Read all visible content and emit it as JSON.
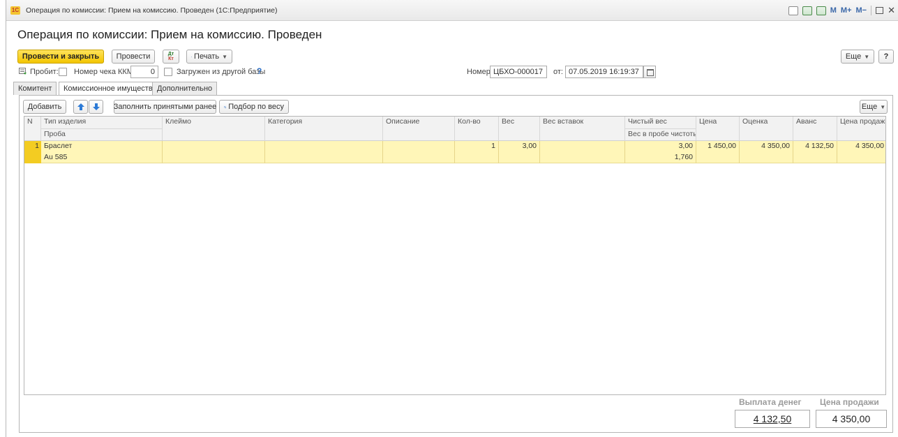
{
  "window": {
    "title": "Операция по комиссии: Прием на комиссию. Проведен  (1С:Предприятие)",
    "logo": "1С",
    "memory_buttons": [
      "M",
      "M+",
      "M−"
    ]
  },
  "document": {
    "title": "Операция по комиссии: Прием на комиссию. Проведен"
  },
  "toolbar": {
    "post_close": "Провести и закрыть",
    "post": "Провести",
    "dtkt_top": "Дт",
    "dtkt_bottom": "Кт",
    "print": "Печать",
    "more": "Еще",
    "help": "?"
  },
  "header": {
    "probit_label": "Пробит:",
    "kkm_label": "Номер чека ККМ:",
    "kkm_value": "0",
    "loaded_label": "Загружен из другой базы",
    "loaded_help": "?",
    "number_label": "Номер:",
    "number_value": "ЦБХО-000017",
    "date_label": "от:",
    "date_value": "07.05.2019 16:19:37"
  },
  "tabs": [
    "Комитент",
    "Комиссионное имущество",
    "Дополнительно"
  ],
  "table_toolbar": {
    "add": "Добавить",
    "fill": "Заполнить принятыми ранее",
    "by_weight": "Подбор по весу",
    "more": "Еще"
  },
  "table": {
    "headers": [
      "N",
      "Тип изделия",
      "Клеймо",
      "Категория",
      "Описание",
      "Кол-во",
      "Вес",
      "Вес вставок",
      "Чистый вес",
      "Цена",
      "Оценка",
      "Аванс",
      "Цена продажи"
    ],
    "subheaders": {
      "type": "Проба",
      "net": "Вес в пробе чистоты"
    },
    "rows": [
      {
        "n": "1",
        "type": "Браслет",
        "proba": "Au 585",
        "mark": "",
        "category": "",
        "description": "",
        "qty": "1",
        "weight": "3,00",
        "insert_weight": "",
        "net_weight": "3,00",
        "net_weight_pure": "1,760",
        "price": "1 450,00",
        "estimate": "4 350,00",
        "advance": "4 132,50",
        "sale_price": "4 350,00"
      }
    ]
  },
  "totals": {
    "payout_label": "Выплата денег",
    "payout_value": "4 132,50",
    "sale_label": "Цена продажи",
    "sale_value": "4 350,00"
  }
}
